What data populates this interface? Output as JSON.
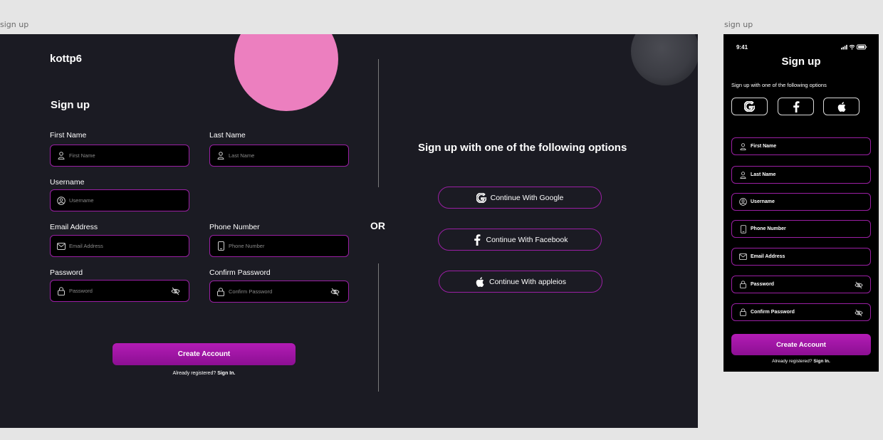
{
  "frames": {
    "desktop_label": "sign up",
    "mobile_label": "sign up"
  },
  "desktop": {
    "brand": "kottp6",
    "form_title": "Sign up",
    "fields": {
      "first_name": {
        "label": "First Name",
        "placeholder": "First Name",
        "icon": "user-icon"
      },
      "last_name": {
        "label": "Last Name",
        "placeholder": "Last Name",
        "icon": "user-icon"
      },
      "username": {
        "label": "Username",
        "placeholder": "Username",
        "icon": "user-circle-icon"
      },
      "email": {
        "label": "Email Address",
        "placeholder": "Email Address",
        "icon": "mail-icon"
      },
      "phone": {
        "label": "Phone Number",
        "placeholder": "Phone Number",
        "icon": "phone-icon"
      },
      "password": {
        "label": "Password",
        "placeholder": "Password",
        "icon": "lock-icon"
      },
      "confirm_password": {
        "label": "Confirm Password",
        "placeholder": "Confirm Password",
        "icon": "lock-icon"
      }
    },
    "create_button": "Create Account",
    "already_registered": "Already registered?",
    "sign_in_link": "Sign In.",
    "or_text": "OR",
    "social_title": "Sign up with one of the following options",
    "social_buttons": {
      "google": "Continue With Google",
      "facebook": "Continue With Facebook",
      "apple": "Continue With appleios"
    }
  },
  "mobile": {
    "time": "9:41",
    "title": "Sign up",
    "subtitle": "Sign up with one of the following options",
    "fields": {
      "first_name": "First Name",
      "last_name": "Last Name",
      "username": "Username",
      "phone": "Phone Number",
      "email": "Email Address",
      "password": "Password",
      "confirm_password": "Confirm Password"
    },
    "create_button": "Create Account",
    "already_registered": "Already registered?",
    "sign_in_link": "Sign In."
  },
  "colors": {
    "desktop_bg": "#1b1b23",
    "accent": "#9b1fa4",
    "button_gradient_top": "#b31cb5",
    "pink_circle": "#ec7fbf"
  }
}
